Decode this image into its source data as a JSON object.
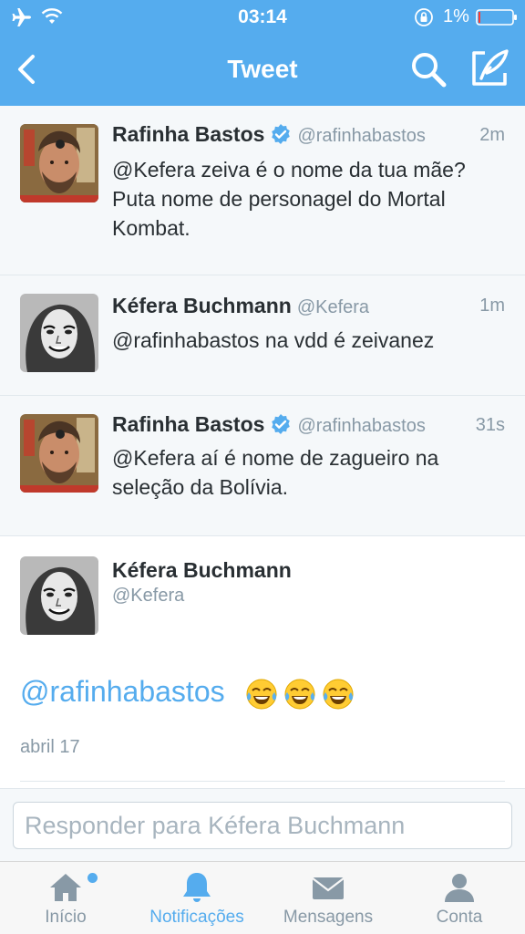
{
  "status_bar": {
    "time": "03:14",
    "battery_percent": "1%",
    "icons": [
      "airplane-icon",
      "wifi-icon",
      "rotation-lock-icon",
      "battery-icon"
    ]
  },
  "nav": {
    "title": "Tweet",
    "icons": [
      "back-icon",
      "search-icon",
      "compose-icon"
    ]
  },
  "tweets": [
    {
      "name": "Rafinha Bastos",
      "verified": true,
      "handle": "@rafinhabastos",
      "time": "2m",
      "lines": [
        "@Kefera zeiva é o nome da tua mãe?",
        "Puta nome de personagel do Mortal",
        "Kombat."
      ]
    },
    {
      "name": "Kéfera Buchmann",
      "verified": false,
      "handle": "@Kefera",
      "time": "1m",
      "lines": [
        "@rafinhabastos na vdd é zeivanez"
      ]
    },
    {
      "name": "Rafinha Bastos",
      "verified": true,
      "handle": "@rafinhabastos",
      "time": "31s",
      "lines": [
        "@Kefera aí é nome de zagueiro na",
        "seleção da Bolívia."
      ]
    }
  ],
  "focused_tweet": {
    "name": "Kéfera Buchmann",
    "handle": "@Kefera",
    "text": "@rafinhabastos",
    "emoji": [
      "😂",
      "😂",
      "😂"
    ],
    "date": "abril 17"
  },
  "reply": {
    "placeholder": "Responder para Kéfera Buchmann"
  },
  "tabs": [
    {
      "label": "Início",
      "icon": "home-icon",
      "active": false,
      "badge": true
    },
    {
      "label": "Notificações",
      "icon": "bell-icon",
      "active": true,
      "badge": false
    },
    {
      "label": "Mensagens",
      "icon": "envelope-icon",
      "active": false,
      "badge": false
    },
    {
      "label": "Conta",
      "icon": "person-icon",
      "active": false,
      "badge": false
    }
  ],
  "colors": {
    "brand": "#55acee",
    "text": "#292f33",
    "muted": "#8899a6",
    "tab_inactive": "#8899a6"
  }
}
